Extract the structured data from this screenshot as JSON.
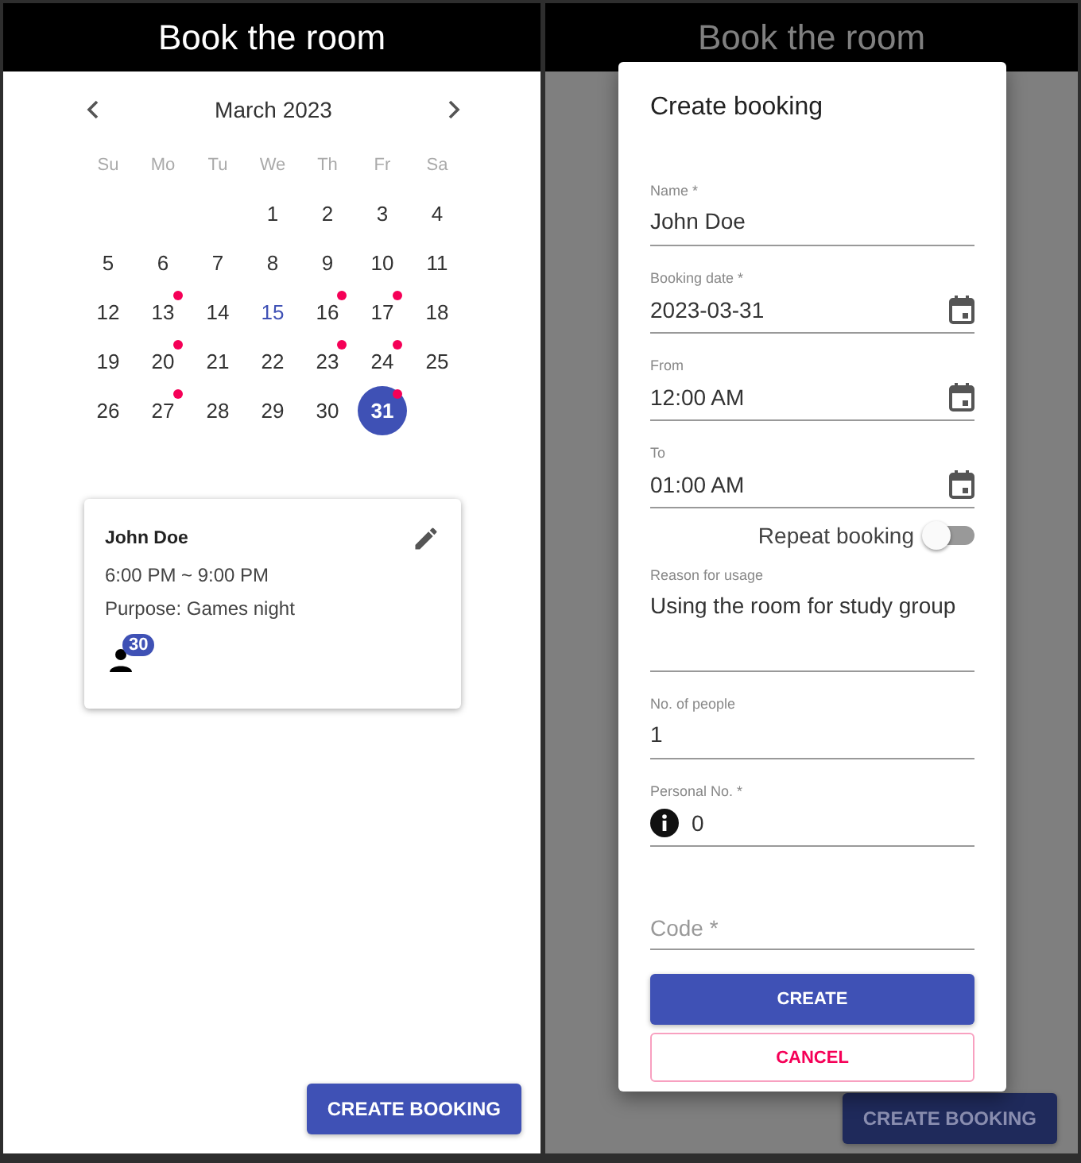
{
  "booking_screen": {
    "title": "Book the room",
    "calendar": {
      "month": "March 2023",
      "weekdays": [
        "Su",
        "Mo",
        "Tu",
        "We",
        "Th",
        "Fr",
        "Sa"
      ],
      "weeks": [
        [
          {
            "day": "1",
            "booked": false,
            "today": false,
            "selected": false
          },
          {
            "day": "2",
            "booked": false,
            "today": false,
            "selected": false
          },
          {
            "day": "3",
            "booked": false,
            "today": false,
            "selected": false
          },
          {
            "day": "4",
            "booked": false,
            "today": false,
            "selected": false
          }
        ],
        [
          {
            "day": "5",
            "booked": false,
            "today": false,
            "selected": false
          },
          {
            "day": "6",
            "booked": false,
            "today": false,
            "selected": false
          },
          {
            "day": "7",
            "booked": false,
            "today": false,
            "selected": false
          },
          {
            "day": "8",
            "booked": false,
            "today": false,
            "selected": false
          },
          {
            "day": "9",
            "booked": false,
            "today": false,
            "selected": false
          },
          {
            "day": "10",
            "booked": false,
            "today": false,
            "selected": false
          },
          {
            "day": "11",
            "booked": false,
            "today": false,
            "selected": false
          }
        ],
        [
          {
            "day": "12",
            "booked": false,
            "today": false,
            "selected": false
          },
          {
            "day": "13",
            "booked": true,
            "today": false,
            "selected": false
          },
          {
            "day": "14",
            "booked": false,
            "today": false,
            "selected": false
          },
          {
            "day": "15",
            "booked": false,
            "today": true,
            "selected": false
          },
          {
            "day": "16",
            "booked": true,
            "today": false,
            "selected": false
          },
          {
            "day": "17",
            "booked": true,
            "today": false,
            "selected": false
          },
          {
            "day": "18",
            "booked": false,
            "today": false,
            "selected": false
          }
        ],
        [
          {
            "day": "19",
            "booked": false,
            "today": false,
            "selected": false
          },
          {
            "day": "20",
            "booked": true,
            "today": false,
            "selected": false
          },
          {
            "day": "21",
            "booked": false,
            "today": false,
            "selected": false
          },
          {
            "day": "22",
            "booked": false,
            "today": false,
            "selected": false
          },
          {
            "day": "23",
            "booked": true,
            "today": false,
            "selected": false
          },
          {
            "day": "24",
            "booked": true,
            "today": false,
            "selected": false
          },
          {
            "day": "25",
            "booked": false,
            "today": false,
            "selected": false
          }
        ],
        [
          {
            "day": "26",
            "booked": false,
            "today": false,
            "selected": false
          },
          {
            "day": "27",
            "booked": true,
            "today": false,
            "selected": false
          },
          {
            "day": "28",
            "booked": false,
            "today": false,
            "selected": false
          },
          {
            "day": "29",
            "booked": false,
            "today": false,
            "selected": false
          },
          {
            "day": "30",
            "booked": false,
            "today": false,
            "selected": false
          },
          {
            "day": "31",
            "booked": true,
            "today": false,
            "selected": true
          }
        ]
      ]
    },
    "booking_card": {
      "name": "John Doe",
      "time": "6:00 PM ~ 9:00 PM",
      "purpose": "Purpose: Games night",
      "people_count": "30"
    },
    "create_button": "CREATE BOOKING"
  },
  "dialog_screen": {
    "background_title": "Book the room",
    "background_button": "CREATE BOOKING",
    "dialog": {
      "title": "Create booking",
      "fields": [
        {
          "kind": "text",
          "label": "Name *",
          "value": "John Doe"
        },
        {
          "kind": "date",
          "label": "Booking date *",
          "value": "2023-03-31"
        },
        {
          "kind": "date",
          "label": "From",
          "value": "12:00 AM"
        },
        {
          "kind": "date",
          "label": "To",
          "value": "01:00 AM"
        },
        {
          "kind": "toggle",
          "label": "Repeat booking",
          "on": false
        },
        {
          "kind": "multiline",
          "label": "Reason for usage",
          "value": "Using the room for study group"
        },
        {
          "kind": "text",
          "label": "No. of people",
          "value": "1"
        },
        {
          "kind": "info",
          "label": "Personal No. *",
          "value": "0"
        },
        {
          "kind": "empty",
          "placeholder": "Code *"
        }
      ],
      "create": "CREATE",
      "cancel": "CANCEL"
    }
  }
}
